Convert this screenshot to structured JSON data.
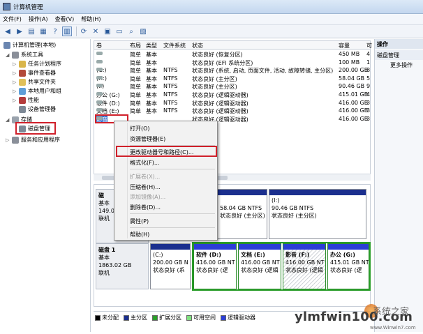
{
  "window": {
    "title": "计算机管理"
  },
  "menu": [
    "文件(F)",
    "操作(A)",
    "查看(V)",
    "帮助(H)"
  ],
  "tree": {
    "root": "计算机管理(本地)",
    "system_tools": "系统工具",
    "task_scheduler": "任务计划程序",
    "event_viewer": "事件查看器",
    "shared_folders": "共享文件夹",
    "local_users": "本地用户和组",
    "performance": "性能",
    "device_manager": "设备管理器",
    "storage": "存储",
    "disk_management": "磁盘管理",
    "services": "服务和应用程序"
  },
  "columns": [
    "卷",
    "布局",
    "类型",
    "文件系统",
    "状态",
    "容量",
    "可"
  ],
  "volumes": [
    {
      "name": "",
      "layout": "简单",
      "type": "基本",
      "fs": "",
      "status": "状态良好 (恢复分区)",
      "capacity": "450 MB",
      "free": "4"
    },
    {
      "name": "",
      "layout": "简单",
      "type": "基本",
      "fs": "",
      "status": "状态良好 (EFI 系统分区)",
      "capacity": "100 MB",
      "free": "1"
    },
    {
      "name": "(C:)",
      "layout": "简单",
      "type": "基本",
      "fs": "NTFS",
      "status": "状态良好 (系统, 启动, 页面文件, 活动, 故障转储, 主分区)",
      "capacity": "200.00 GB",
      "free": "8"
    },
    {
      "name": "(H:)",
      "layout": "简单",
      "type": "基本",
      "fs": "NTFS",
      "status": "状态良好 (主分区)",
      "capacity": "58.04 GB",
      "free": "5"
    },
    {
      "name": "(I:)",
      "layout": "简单",
      "type": "基本",
      "fs": "NTFS",
      "status": "状态良好 (主分区)",
      "capacity": "90.46 GB",
      "free": "9"
    },
    {
      "name": "办公 (G:)",
      "layout": "简单",
      "type": "基本",
      "fs": "NTFS",
      "status": "状态良好 (逻辑驱动器)",
      "capacity": "415.01 GB",
      "free": "4"
    },
    {
      "name": "软件 (D:)",
      "layout": "简单",
      "type": "基本",
      "fs": "NTFS",
      "status": "状态良好 (逻辑驱动器)",
      "capacity": "416.00 GB",
      "free": "3"
    },
    {
      "name": "文档 (E:)",
      "layout": "简单",
      "type": "基本",
      "fs": "NTFS",
      "status": "状态良好 (逻辑驱动器)",
      "capacity": "416.00 GB",
      "free": "3"
    },
    {
      "name": "影音",
      "layout": "",
      "type": "",
      "fs": "",
      "status": "状态良好 (逻辑驱动器)",
      "capacity": "416.00 GB",
      "free": "3"
    }
  ],
  "context_menu": {
    "open": "打开(O)",
    "explorer": "资源管理器(E)",
    "change_letter": "更改驱动器号和路径(C)...",
    "format": "格式化(F)...",
    "extend": "扩展卷(X)...",
    "shrink": "压缩卷(H)...",
    "add_mirror": "添加镜像(A)...",
    "delete": "删除卷(D)...",
    "properties": "属性(P)",
    "help": "帮助(H)"
  },
  "disk0": {
    "label": "磁",
    "type": "基本",
    "size": "149.0",
    "status": "联机",
    "part_h": {
      "size": "58.04 GB NTFS",
      "status": "状态良好 (主分区)"
    },
    "part_i": {
      "title": "(I:)",
      "size": "90.46 GB NTFS",
      "status": "状态良好 (主分区)"
    }
  },
  "disk1": {
    "label": "磁盘 1",
    "type": "基本",
    "size": "1863.02 GB",
    "status": "联机",
    "partitions": [
      {
        "title": "(C:)",
        "size": "200.00 GB N",
        "status": "状态良好 (系"
      },
      {
        "title": "软件  (D:)",
        "size": "416.00 GB NT",
        "status": "状态良好 (逻"
      },
      {
        "title": "文档  (E:)",
        "size": "416.00 GB NT",
        "status": "状态良好 (逻辑"
      },
      {
        "title": "影音  (F:)",
        "size": "416.00 GB NT",
        "status": "状态良好 (逻辑"
      },
      {
        "title": "办公  (G:)",
        "size": "415.01 GB NT",
        "status": "状态良好 (逻"
      }
    ]
  },
  "legend": [
    {
      "label": "未分配",
      "color": "#000000"
    },
    {
      "label": "主分区",
      "color": "#1b2f8e"
    },
    {
      "label": "扩展分区",
      "color": "#2a9e2a"
    },
    {
      "label": "可用空间",
      "color": "#7fe07f"
    },
    {
      "label": "逻辑驱动器",
      "color": "#2b3ed6"
    }
  ],
  "actions": {
    "header": "操作",
    "section": "磁盘管理",
    "more": "更多操作"
  },
  "watermark": {
    "site": "ylmfwin100.com",
    "brand": "系统之家",
    "url": "www.Winwin7.com"
  }
}
